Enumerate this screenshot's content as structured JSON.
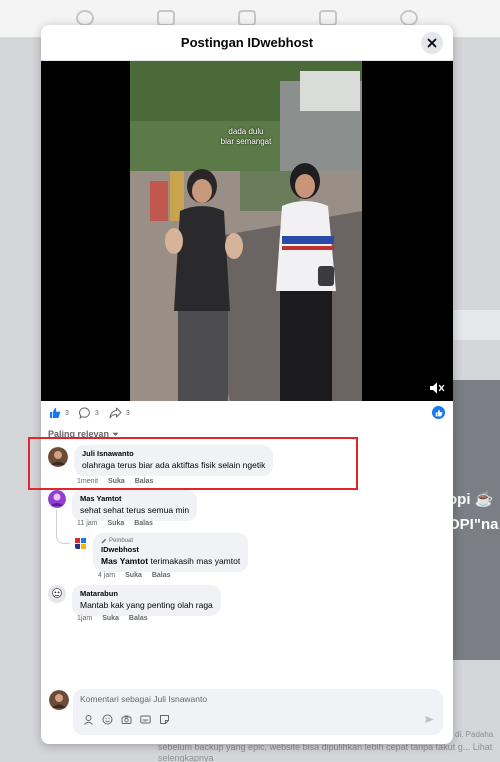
{
  "dialog": {
    "title": "Postingan IDwebhost",
    "video_caption_line1": "dada dulu",
    "video_caption_line2": "biar semangat"
  },
  "reactions": {
    "like_count": "3",
    "comment_count": "3",
    "share_count": "3"
  },
  "sort_label": "Paling relevan",
  "comments": [
    {
      "author": "Juli Isnawanto",
      "text": "olahraga terus biar ada aktiftas fisik selain ngetik",
      "time": "1menit",
      "like": "Suka",
      "reply": "Balas"
    },
    {
      "author": "Mas Yamtot",
      "text": "sehat sehat terus semua min",
      "time": "11 jam",
      "like": "Suka",
      "reply": "Balas"
    },
    {
      "creator_label": "Pembuat",
      "author": "IDwebhost",
      "mention": "Mas Yamtot",
      "text": " terimakasih mas yamtot",
      "time": "4 jam",
      "like": "Suka",
      "reply": "Balas"
    },
    {
      "author": "Matarabun",
      "text": "Mantab kak yang penting olah raga",
      "time": "1jam",
      "like": "Suka",
      "reply": "Balas"
    }
  ],
  "composer": {
    "placeholder": "Komentari sebagai Juli Isnawanto"
  },
  "background": {
    "card_text_1": "opi ☕",
    "card_text_2": "OPI\"na",
    "bottom_text": "sebelum backup yang epic, website bisa dipulihkan lebih cepat tanpa takut g... Lihat selengkapnya",
    "bottom_text_2": "di. Padaha"
  },
  "colors": {
    "accent": "#1877f2",
    "highlight": "#e0262d"
  }
}
